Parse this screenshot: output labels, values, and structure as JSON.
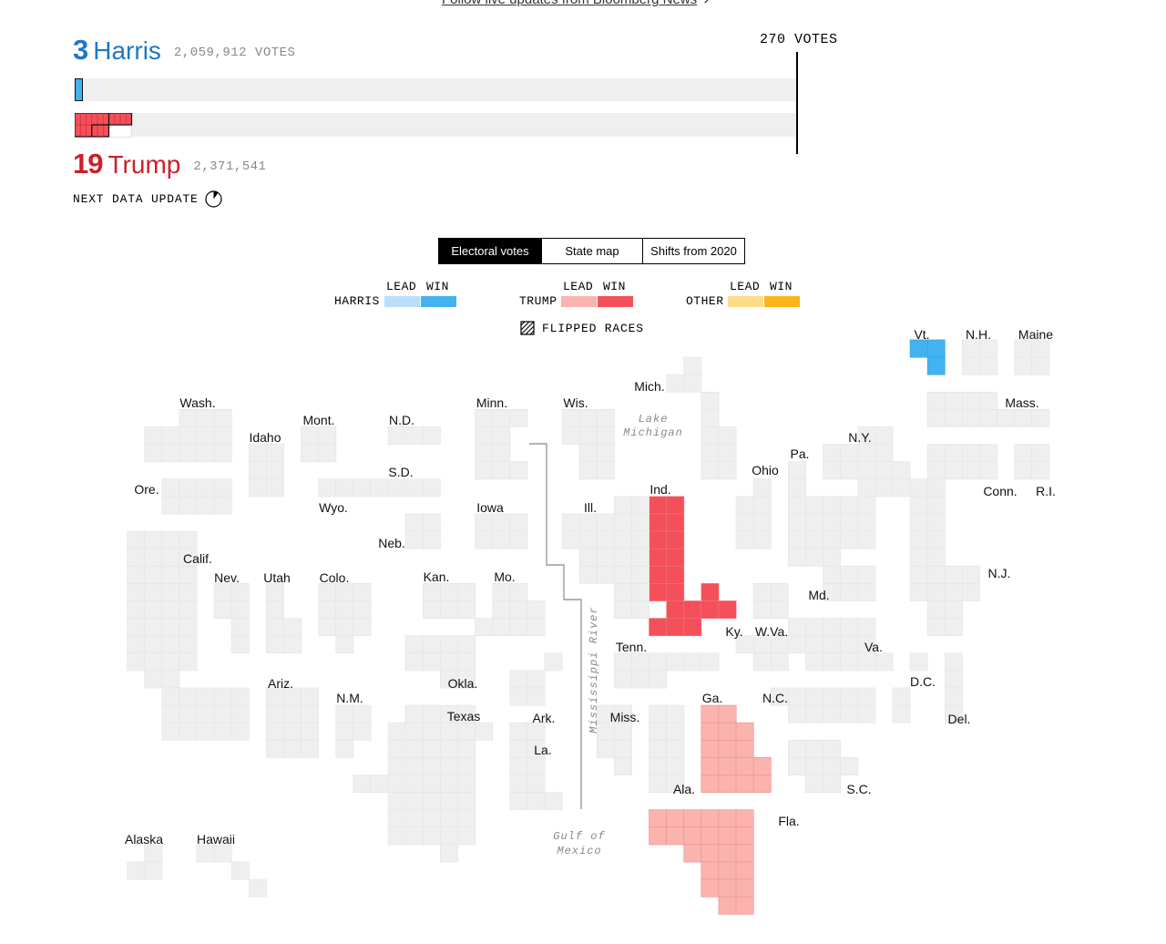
{
  "top_link": {
    "text": "Follow live updates from Bloomberg News",
    "arrow": "↗"
  },
  "harris": {
    "electoral_votes": "3",
    "name": "Harris",
    "popular_votes": "2,059,912 VOTES",
    "color": "#1d78c4",
    "bar_fill_votes": 3
  },
  "trump": {
    "electoral_votes": "19",
    "name": "Trump",
    "popular_votes": "2,371,541",
    "color": "#cc1f2b",
    "bar_fill_votes": 19
  },
  "threshold": {
    "label": "270 VOTES",
    "votes": 270
  },
  "next_update": {
    "label": "NEXT DATA UPDATE",
    "icon": "timer-icon"
  },
  "tabs": [
    {
      "label": "Electoral votes",
      "active": true
    },
    {
      "label": "State map",
      "active": false
    },
    {
      "label": "Shifts from 2020",
      "active": false
    }
  ],
  "legend": {
    "lead_label": "LEAD",
    "win_label": "WIN",
    "groups": [
      {
        "name": "HARRIS",
        "lead_color": "#b9defb",
        "win_color": "#43b2f0"
      },
      {
        "name": "TRUMP",
        "lead_color": "#fbb3ad",
        "win_color": "#f54f5a"
      },
      {
        "name": "OTHER",
        "lead_color": "#fddc89",
        "win_color": "#f9b51a"
      }
    ],
    "flipped_label": "FLIPPED RACES",
    "flipped_icon": "hatched-square-icon"
  },
  "map": {
    "states": [
      {
        "name": "Vt.",
        "status": "harris-win",
        "electoral_votes": 3
      },
      {
        "name": "N.H.",
        "status": "none"
      },
      {
        "name": "Maine",
        "status": "none"
      },
      {
        "name": "Mich.",
        "status": "none"
      },
      {
        "name": "Wash.",
        "status": "none"
      },
      {
        "name": "Mont.",
        "status": "none"
      },
      {
        "name": "N.D.",
        "status": "none"
      },
      {
        "name": "Minn.",
        "status": "none"
      },
      {
        "name": "Wis.",
        "status": "none"
      },
      {
        "name": "Mass.",
        "status": "none"
      },
      {
        "name": "Idaho",
        "status": "none"
      },
      {
        "name": "N.Y.",
        "status": "none"
      },
      {
        "name": "Pa.",
        "status": "none"
      },
      {
        "name": "Ohio",
        "status": "none"
      },
      {
        "name": "S.D.",
        "status": "none"
      },
      {
        "name": "Ore.",
        "status": "none"
      },
      {
        "name": "Ind.",
        "status": "trump-win",
        "electoral_votes": 11
      },
      {
        "name": "Conn.",
        "status": "none"
      },
      {
        "name": "R.I.",
        "status": "none"
      },
      {
        "name": "Wyo.",
        "status": "none"
      },
      {
        "name": "Iowa",
        "status": "none"
      },
      {
        "name": "Ill.",
        "status": "none"
      },
      {
        "name": "Neb.",
        "status": "none"
      },
      {
        "name": "Calif.",
        "status": "none"
      },
      {
        "name": "Nev.",
        "status": "none"
      },
      {
        "name": "Utah",
        "status": "none"
      },
      {
        "name": "Colo.",
        "status": "none"
      },
      {
        "name": "Kan.",
        "status": "none"
      },
      {
        "name": "Mo.",
        "status": "none"
      },
      {
        "name": "N.J.",
        "status": "none"
      },
      {
        "name": "Md.",
        "status": "none"
      },
      {
        "name": "Ky.",
        "status": "trump-win",
        "electoral_votes": 8
      },
      {
        "name": "W.Va.",
        "status": "none"
      },
      {
        "name": "Tenn.",
        "status": "none"
      },
      {
        "name": "Va.",
        "status": "none"
      },
      {
        "name": "D.C.",
        "status": "none"
      },
      {
        "name": "Ariz.",
        "status": "none"
      },
      {
        "name": "Okla.",
        "status": "none"
      },
      {
        "name": "N.M.",
        "status": "none"
      },
      {
        "name": "Ga.",
        "status": "trump-lead"
      },
      {
        "name": "N.C.",
        "status": "none"
      },
      {
        "name": "Texas",
        "status": "none"
      },
      {
        "name": "Ark.",
        "status": "none"
      },
      {
        "name": "Miss.",
        "status": "none"
      },
      {
        "name": "Del.",
        "status": "none"
      },
      {
        "name": "La.",
        "status": "none"
      },
      {
        "name": "Ala.",
        "status": "none"
      },
      {
        "name": "S.C.",
        "status": "none"
      },
      {
        "name": "Fla.",
        "status": "trump-lead"
      },
      {
        "name": "Alaska",
        "status": "none"
      },
      {
        "name": "Hawaii",
        "status": "none"
      }
    ],
    "water_labels": {
      "lake_michigan": [
        "Lake",
        "Michigan"
      ],
      "mississippi": "Mississippi River",
      "gulf": [
        "Gulf of",
        "Mexico"
      ]
    },
    "empty_color": "#efefef"
  }
}
